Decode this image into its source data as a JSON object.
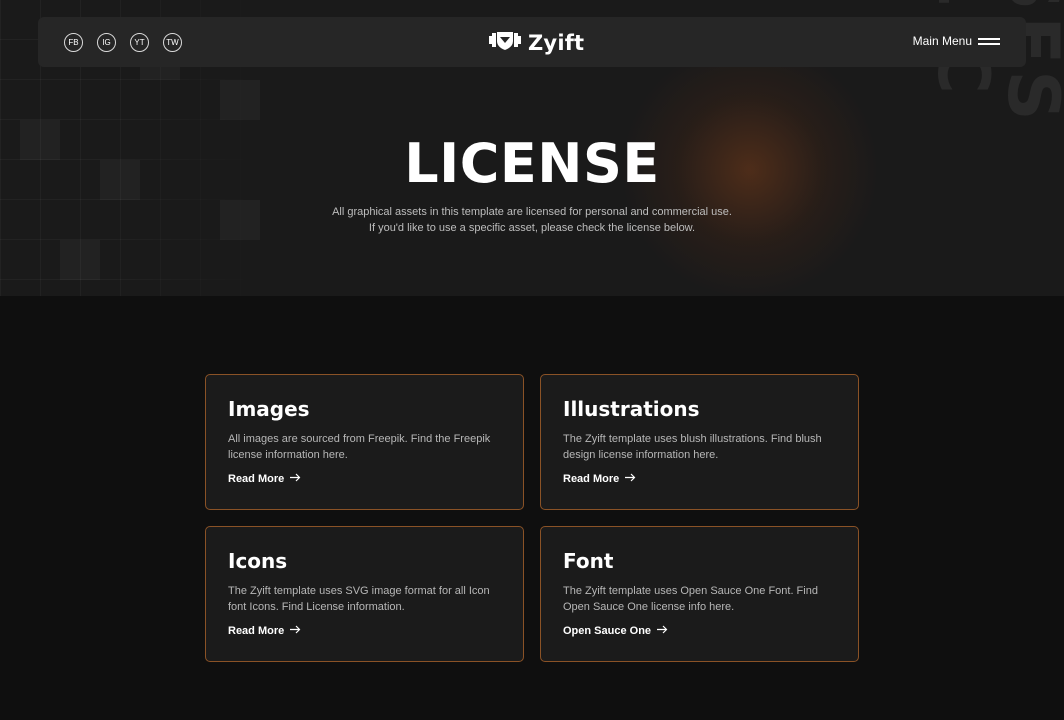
{
  "header": {
    "social": [
      "FB",
      "IG",
      "YT",
      "TW"
    ],
    "logo_text": "Zyift",
    "menu_label": "Main Menu"
  },
  "hero": {
    "title": "LICENSE",
    "description": "All graphical assets in this template are licensed for personal and commercial use. If you'd like to use a specific asset, please check the license below.",
    "vertical_text": "SES LIC"
  },
  "cards": [
    {
      "title": "Images",
      "description": "All images are sourced from Freepik. Find the Freepik license information here.",
      "link": "Read More"
    },
    {
      "title": "Illustrations",
      "description": "The Zyift template uses blush illustrations. Find blush design license information here.",
      "link": "Read More"
    },
    {
      "title": "Icons",
      "description": "The Zyift template uses SVG image format for all Icon font Icons. Find License information.",
      "link": "Read More"
    },
    {
      "title": "Font",
      "description": "The Zyift template uses Open Sauce One Font. Find Open Sauce One license info here.",
      "link": "Open Sauce One"
    }
  ],
  "colors": {
    "background": "#0f0f0f",
    "hero_background": "#1a1a1a",
    "header_background": "#262626",
    "card_background": "#1b1b1b",
    "card_border": "#8a5226",
    "accent_glow": "#783c19"
  },
  "icons": {
    "logo": "dumbbell-shield-icon",
    "menu": "hamburger-icon",
    "link_arrow": "arrow-right-icon"
  }
}
